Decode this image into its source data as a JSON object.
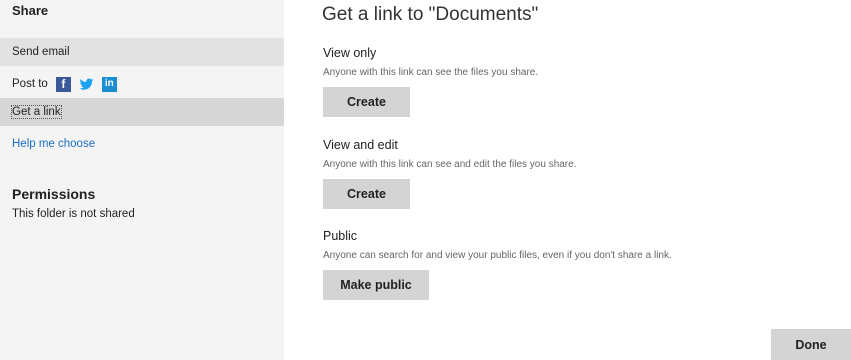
{
  "sidebar": {
    "share_heading": "Share",
    "send_email": "Send email",
    "post_to": "Post to",
    "social_icons": [
      "facebook-icon",
      "twitter-icon",
      "linkedin-icon"
    ],
    "get_link": "Get a link",
    "help_me_choose": "Help me choose",
    "permissions_heading": "Permissions",
    "permissions_text": "This folder is not shared"
  },
  "main": {
    "title": "Get a link to \"Documents\"",
    "sections": [
      {
        "heading": "View only",
        "description": "Anyone with this link can see the files you share.",
        "button": "Create"
      },
      {
        "heading": "View and edit",
        "description": "Anyone with this link can see and edit the files you share.",
        "button": "Create"
      },
      {
        "heading": "Public",
        "description": "Anyone can search for and view your public files, even if you don't share a link.",
        "button": "Make public"
      }
    ],
    "done": "Done"
  },
  "colors": {
    "sidebar_bg": "#f4f4f4",
    "selected_bg": "#d6d6d6",
    "link": "#1b6ec2",
    "button_bg": "#d4d4d4",
    "facebook": "#3b5998",
    "twitter": "#1da1f2",
    "linkedin": "#1a8ed1"
  }
}
